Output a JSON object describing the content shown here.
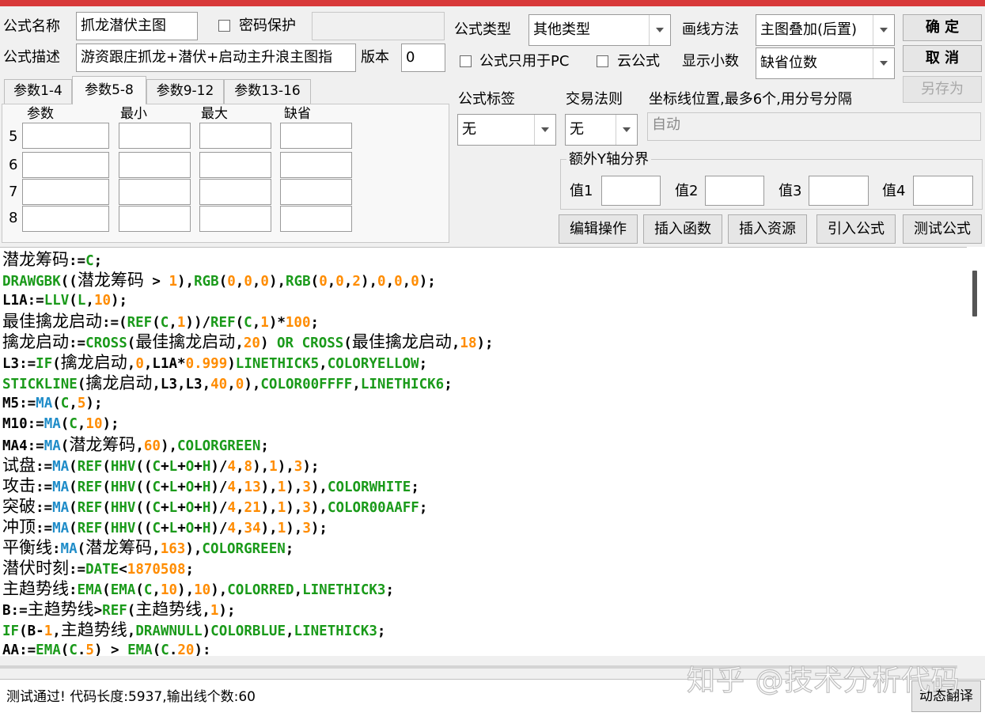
{
  "header": {
    "formula_name_label": "公式名称",
    "formula_name_value": "抓龙潜伏主图",
    "password_label": "密码保护",
    "desc_label": "公式描述",
    "desc_value": "游资跟庄抓龙+潜伏+启动主升浪主图指",
    "version_label": "版本",
    "version_value": "0"
  },
  "settings": {
    "type_label": "公式类型",
    "type_value": "其他类型",
    "draw_label": "画线方法",
    "draw_value": "主图叠加(后置)",
    "pc_only_label": "公式只用于PC",
    "cloud_label": "云公式",
    "decimal_label": "显示小数",
    "decimal_value": "缺省位数",
    "tag_label": "公式标签",
    "tag_value": "无",
    "trade_label": "交易法则",
    "trade_value": "无",
    "coord_label": "坐标线位置,最多6个,用分号分隔",
    "coord_value": "自动",
    "y_axis_label": "额外Y轴分界",
    "y_vals": [
      "值1",
      "值2",
      "值3",
      "值4"
    ]
  },
  "buttons": {
    "ok": "确  定",
    "cancel": "取  消",
    "save_as": "另存为",
    "edit": "编辑操作",
    "insert_func": "插入函数",
    "insert_res": "插入资源",
    "import": "引入公式",
    "test": "测试公式",
    "translate": "动态翻译"
  },
  "tabs": [
    "参数1-4",
    "参数5-8",
    "参数9-12",
    "参数13-16"
  ],
  "params": {
    "headers": [
      "参数",
      "最小",
      "最大",
      "缺省"
    ],
    "rows": [
      "5",
      "6",
      "7",
      "8"
    ]
  },
  "code_lines": [
    [
      [
        "k",
        "潜龙筹码:="
      ],
      [
        "g",
        "C"
      ],
      [
        "k",
        ";"
      ]
    ],
    [
      [
        "g",
        "DRAWGBK"
      ],
      [
        "k",
        "(("
      ],
      [
        "k",
        "潜龙筹码 > "
      ],
      [
        "o",
        "1"
      ],
      [
        "k",
        "),"
      ],
      [
        "g",
        "RGB"
      ],
      [
        "k",
        "("
      ],
      [
        "o",
        "0"
      ],
      [
        "k",
        ","
      ],
      [
        "o",
        "0"
      ],
      [
        "k",
        ","
      ],
      [
        "o",
        "0"
      ],
      [
        "k",
        "),"
      ],
      [
        "g",
        "RGB"
      ],
      [
        "k",
        "("
      ],
      [
        "o",
        "0"
      ],
      [
        "k",
        ","
      ],
      [
        "o",
        "0"
      ],
      [
        "k",
        ","
      ],
      [
        "o",
        "2"
      ],
      [
        "k",
        "),"
      ],
      [
        "o",
        "0"
      ],
      [
        "k",
        ","
      ],
      [
        "o",
        "0"
      ],
      [
        "k",
        ","
      ],
      [
        "o",
        "0"
      ],
      [
        "k",
        ");"
      ]
    ],
    [
      [
        "k",
        "L1A:="
      ],
      [
        "g",
        "LLV"
      ],
      [
        "k",
        "("
      ],
      [
        "g",
        "L"
      ],
      [
        "k",
        ","
      ],
      [
        "o",
        "10"
      ],
      [
        "k",
        ");"
      ]
    ],
    [
      [
        "k",
        "最佳擒龙启动:=("
      ],
      [
        "g",
        "REF"
      ],
      [
        "k",
        "("
      ],
      [
        "g",
        "C"
      ],
      [
        "k",
        ","
      ],
      [
        "o",
        "1"
      ],
      [
        "k",
        "))/"
      ],
      [
        "g",
        "REF"
      ],
      [
        "k",
        "("
      ],
      [
        "g",
        "C"
      ],
      [
        "k",
        ","
      ],
      [
        "o",
        "1"
      ],
      [
        "k",
        ")*"
      ],
      [
        "o",
        "100"
      ],
      [
        "k",
        ";"
      ]
    ],
    [
      [
        "k",
        "擒龙启动:="
      ],
      [
        "g",
        "CROSS"
      ],
      [
        "k",
        "(最佳擒龙启动,"
      ],
      [
        "o",
        "20"
      ],
      [
        "k",
        ") "
      ],
      [
        "g",
        "OR CROSS"
      ],
      [
        "k",
        "(最佳擒龙启动,"
      ],
      [
        "o",
        "18"
      ],
      [
        "k",
        ");"
      ]
    ],
    [
      [
        "k",
        "L3:="
      ],
      [
        "g",
        "IF"
      ],
      [
        "k",
        "(擒龙启动,"
      ],
      [
        "o",
        "0"
      ],
      [
        "k",
        ",L1A*"
      ],
      [
        "o",
        "0.999"
      ],
      [
        "k",
        ")"
      ],
      [
        "g",
        "LINETHICK5"
      ],
      [
        "k",
        ","
      ],
      [
        "g",
        "COLORYELLOW"
      ],
      [
        "k",
        ";"
      ]
    ],
    [
      [
        "g",
        "STICKLINE"
      ],
      [
        "k",
        "(擒龙启动,L3,L3,"
      ],
      [
        "o",
        "40"
      ],
      [
        "k",
        ","
      ],
      [
        "o",
        "0"
      ],
      [
        "k",
        "),"
      ],
      [
        "g",
        "COLOR00FFFF"
      ],
      [
        "k",
        ","
      ],
      [
        "g",
        "LINETHICK6"
      ],
      [
        "k",
        ";"
      ]
    ],
    [
      [
        "k",
        "M5:="
      ],
      [
        "b",
        "MA"
      ],
      [
        "k",
        "("
      ],
      [
        "g",
        "C"
      ],
      [
        "k",
        ","
      ],
      [
        "o",
        "5"
      ],
      [
        "k",
        ");"
      ]
    ],
    [
      [
        "k",
        "M10:="
      ],
      [
        "b",
        "MA"
      ],
      [
        "k",
        "("
      ],
      [
        "g",
        "C"
      ],
      [
        "k",
        ","
      ],
      [
        "o",
        "10"
      ],
      [
        "k",
        ");"
      ]
    ],
    [
      [
        "k",
        "MA4:="
      ],
      [
        "b",
        "MA"
      ],
      [
        "k",
        "(潜龙筹码,"
      ],
      [
        "o",
        "60"
      ],
      [
        "k",
        "),"
      ],
      [
        "g",
        "COLORGREEN"
      ],
      [
        "k",
        ";"
      ]
    ],
    [
      [
        "k",
        "试盘:="
      ],
      [
        "b",
        "MA"
      ],
      [
        "k",
        "("
      ],
      [
        "g",
        "REF"
      ],
      [
        "k",
        "("
      ],
      [
        "g",
        "HHV"
      ],
      [
        "k",
        "(("
      ],
      [
        "g",
        "C"
      ],
      [
        "k",
        "+"
      ],
      [
        "g",
        "L"
      ],
      [
        "k",
        "+"
      ],
      [
        "g",
        "O"
      ],
      [
        "k",
        "+"
      ],
      [
        "g",
        "H"
      ],
      [
        "k",
        ")/"
      ],
      [
        "o",
        "4"
      ],
      [
        "k",
        ","
      ],
      [
        "o",
        "8"
      ],
      [
        "k",
        "),"
      ],
      [
        "o",
        "1"
      ],
      [
        "k",
        "),"
      ],
      [
        "o",
        "3"
      ],
      [
        "k",
        ");"
      ]
    ],
    [
      [
        "k",
        "攻击:="
      ],
      [
        "b",
        "MA"
      ],
      [
        "k",
        "("
      ],
      [
        "g",
        "REF"
      ],
      [
        "k",
        "("
      ],
      [
        "g",
        "HHV"
      ],
      [
        "k",
        "(("
      ],
      [
        "g",
        "C"
      ],
      [
        "k",
        "+"
      ],
      [
        "g",
        "L"
      ],
      [
        "k",
        "+"
      ],
      [
        "g",
        "O"
      ],
      [
        "k",
        "+"
      ],
      [
        "g",
        "H"
      ],
      [
        "k",
        ")/"
      ],
      [
        "o",
        "4"
      ],
      [
        "k",
        ","
      ],
      [
        "o",
        "13"
      ],
      [
        "k",
        "),"
      ],
      [
        "o",
        "1"
      ],
      [
        "k",
        "),"
      ],
      [
        "o",
        "3"
      ],
      [
        "k",
        "),"
      ],
      [
        "g",
        "COLORWHITE"
      ],
      [
        "k",
        ";"
      ]
    ],
    [
      [
        "k",
        "突破:="
      ],
      [
        "b",
        "MA"
      ],
      [
        "k",
        "("
      ],
      [
        "g",
        "REF"
      ],
      [
        "k",
        "("
      ],
      [
        "g",
        "HHV"
      ],
      [
        "k",
        "(("
      ],
      [
        "g",
        "C"
      ],
      [
        "k",
        "+"
      ],
      [
        "g",
        "L"
      ],
      [
        "k",
        "+"
      ],
      [
        "g",
        "O"
      ],
      [
        "k",
        "+"
      ],
      [
        "g",
        "H"
      ],
      [
        "k",
        ")/"
      ],
      [
        "o",
        "4"
      ],
      [
        "k",
        ","
      ],
      [
        "o",
        "21"
      ],
      [
        "k",
        "),"
      ],
      [
        "o",
        "1"
      ],
      [
        "k",
        "),"
      ],
      [
        "o",
        "3"
      ],
      [
        "k",
        "),"
      ],
      [
        "g",
        "COLOR00AAFF"
      ],
      [
        "k",
        ";"
      ]
    ],
    [
      [
        "k",
        "冲顶:="
      ],
      [
        "b",
        "MA"
      ],
      [
        "k",
        "("
      ],
      [
        "g",
        "REF"
      ],
      [
        "k",
        "("
      ],
      [
        "g",
        "HHV"
      ],
      [
        "k",
        "(("
      ],
      [
        "g",
        "C"
      ],
      [
        "k",
        "+"
      ],
      [
        "g",
        "L"
      ],
      [
        "k",
        "+"
      ],
      [
        "g",
        "O"
      ],
      [
        "k",
        "+"
      ],
      [
        "g",
        "H"
      ],
      [
        "k",
        ")/"
      ],
      [
        "o",
        "4"
      ],
      [
        "k",
        ","
      ],
      [
        "o",
        "34"
      ],
      [
        "k",
        "),"
      ],
      [
        "o",
        "1"
      ],
      [
        "k",
        "),"
      ],
      [
        "o",
        "3"
      ],
      [
        "k",
        ");"
      ]
    ],
    [
      [
        "k",
        "平衡线:"
      ],
      [
        "b",
        "MA"
      ],
      [
        "k",
        "(潜龙筹码,"
      ],
      [
        "o",
        "163"
      ],
      [
        "k",
        "),"
      ],
      [
        "g",
        "COLORGREEN"
      ],
      [
        "k",
        ";"
      ]
    ],
    [
      [
        "k",
        "潜伏时刻:="
      ],
      [
        "g",
        "DATE"
      ],
      [
        "k",
        "<"
      ],
      [
        "o",
        "1870508"
      ],
      [
        "k",
        ";"
      ]
    ],
    [
      [
        "k",
        "主趋势线:"
      ],
      [
        "g",
        "EMA"
      ],
      [
        "k",
        "("
      ],
      [
        "g",
        "EMA"
      ],
      [
        "k",
        "("
      ],
      [
        "g",
        "C"
      ],
      [
        "k",
        ","
      ],
      [
        "o",
        "10"
      ],
      [
        "k",
        "),"
      ],
      [
        "o",
        "10"
      ],
      [
        "k",
        "),"
      ],
      [
        "g",
        "COLORRED"
      ],
      [
        "k",
        ","
      ],
      [
        "g",
        "LINETHICK3"
      ],
      [
        "k",
        ";"
      ]
    ],
    [
      [
        "k",
        "B:=主趋势线>"
      ],
      [
        "g",
        "REF"
      ],
      [
        "k",
        "(主趋势线,"
      ],
      [
        "o",
        "1"
      ],
      [
        "k",
        ");"
      ]
    ],
    [
      [
        "g",
        "IF"
      ],
      [
        "k",
        "(B-"
      ],
      [
        "o",
        "1"
      ],
      [
        "k",
        ",主趋势线,"
      ],
      [
        "g",
        "DRAWNULL"
      ],
      [
        "k",
        ")"
      ],
      [
        "g",
        "COLORBLUE"
      ],
      [
        "k",
        ","
      ],
      [
        "g",
        "LINETHICK3"
      ],
      [
        "k",
        ";"
      ]
    ],
    [
      [
        "k",
        "AA:="
      ],
      [
        "g",
        "EMA"
      ],
      [
        "k",
        "("
      ],
      [
        "g",
        "C"
      ],
      [
        "k",
        "."
      ],
      [
        "o",
        "5"
      ],
      [
        "k",
        ") > "
      ],
      [
        "g",
        "EMA"
      ],
      [
        "k",
        "("
      ],
      [
        "g",
        "C"
      ],
      [
        "k",
        "."
      ],
      [
        "o",
        "20"
      ],
      [
        "k",
        "):"
      ]
    ]
  ],
  "status": "测试通过! 代码长度:5937,输出线个数:60",
  "watermark": "知乎 @技术分析代码",
  "colors": {
    "title_bar": "#d8393a",
    "keyword": "#1a9a1a",
    "number": "#ff8c00",
    "ma": "#1f8cc8"
  }
}
